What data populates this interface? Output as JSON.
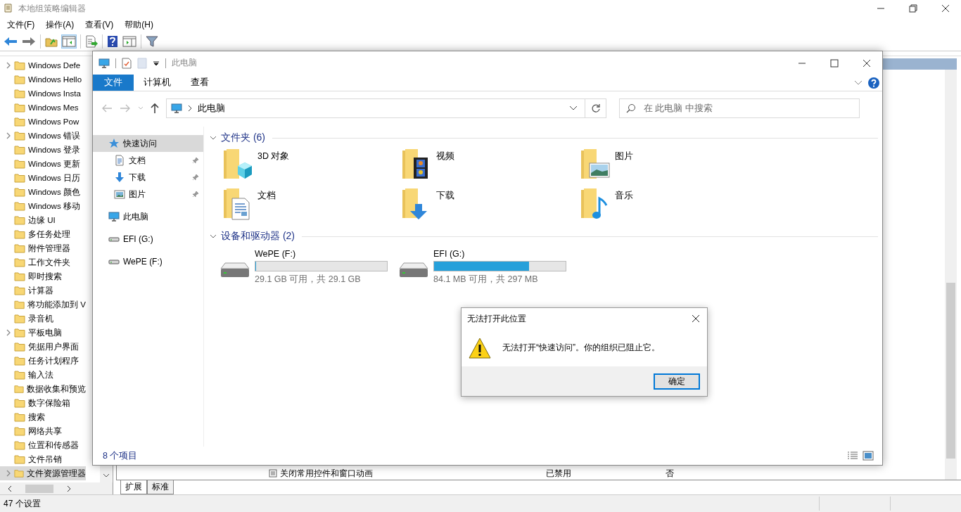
{
  "app_window": {
    "title": "本地组策略编辑器",
    "menu": [
      "文件(F)",
      "操作(A)",
      "查看(V)",
      "帮助(H)"
    ]
  },
  "tree": {
    "items": [
      {
        "label": "Windows Defe",
        "expandable": true,
        "selected": false
      },
      {
        "label": "Windows Hello",
        "expandable": false,
        "selected": false
      },
      {
        "label": "Windows Insta",
        "expandable": false,
        "selected": false
      },
      {
        "label": "Windows Mes",
        "expandable": false,
        "selected": false
      },
      {
        "label": "Windows Pow",
        "expandable": false,
        "selected": false
      },
      {
        "label": "Windows 错误",
        "expandable": true,
        "selected": false
      },
      {
        "label": "Windows 登录",
        "expandable": false,
        "selected": false
      },
      {
        "label": "Windows 更新",
        "expandable": false,
        "selected": false
      },
      {
        "label": "Windows 日历",
        "expandable": false,
        "selected": false
      },
      {
        "label": "Windows 颜色",
        "expandable": false,
        "selected": false
      },
      {
        "label": "Windows 移动",
        "expandable": false,
        "selected": false
      },
      {
        "label": "边缘 UI",
        "expandable": false,
        "selected": false
      },
      {
        "label": "多任务处理",
        "expandable": false,
        "selected": false
      },
      {
        "label": "附件管理器",
        "expandable": false,
        "selected": false
      },
      {
        "label": "工作文件夹",
        "expandable": false,
        "selected": false
      },
      {
        "label": "即时搜索",
        "expandable": false,
        "selected": false
      },
      {
        "label": "计算器",
        "expandable": false,
        "selected": false
      },
      {
        "label": "将功能添加到 V",
        "expandable": false,
        "selected": false
      },
      {
        "label": "录音机",
        "expandable": false,
        "selected": false
      },
      {
        "label": "平板电脑",
        "expandable": true,
        "selected": false
      },
      {
        "label": "凭据用户界面",
        "expandable": false,
        "selected": false
      },
      {
        "label": "任务计划程序",
        "expandable": false,
        "selected": false
      },
      {
        "label": "输入法",
        "expandable": false,
        "selected": false
      },
      {
        "label": "数据收集和预览",
        "expandable": false,
        "selected": false
      },
      {
        "label": "数字保险箱",
        "expandable": false,
        "selected": false
      },
      {
        "label": "搜索",
        "expandable": false,
        "selected": false
      },
      {
        "label": "网络共享",
        "expandable": false,
        "selected": false
      },
      {
        "label": "位置和传感器",
        "expandable": false,
        "selected": false
      },
      {
        "label": "文件吊销",
        "expandable": false,
        "selected": false
      },
      {
        "label": "文件资源管理器",
        "expandable": true,
        "selected": true
      }
    ]
  },
  "settings_table": {
    "rows": [
      {
        "name": "关闭常用控件和窗口动画",
        "state": "已禁用",
        "comment": "否"
      }
    ]
  },
  "view_tabs": [
    {
      "label": "扩展",
      "selected": true
    },
    {
      "label": "标准",
      "selected": false
    }
  ],
  "status_bar": "47 个设置",
  "explorer": {
    "title": "此电脑",
    "ribbon_tabs": [
      {
        "label": "文件",
        "selected": true
      },
      {
        "label": "计算机",
        "selected": false
      },
      {
        "label": "查看",
        "selected": false
      }
    ],
    "address": "此电脑",
    "search": {
      "placeholder": "在 此电脑 中搜索"
    },
    "nav": [
      {
        "label": "快速访问",
        "selected": true,
        "children": [
          {
            "label": "文档",
            "pinned": true,
            "selected": false
          },
          {
            "label": "下载",
            "pinned": true,
            "selected": false
          },
          {
            "label": "图片",
            "pinned": true,
            "selected": false
          }
        ]
      },
      {
        "label": "此电脑",
        "selected": false
      },
      {
        "label": "EFI (G:)",
        "selected": false
      },
      {
        "label": "WePE (F:)",
        "selected": false
      }
    ],
    "sections": [
      {
        "title": "文件夹 (6)",
        "kind": "folders",
        "expanded": true,
        "items": [
          {
            "label": "3D 对象"
          },
          {
            "label": "视频"
          },
          {
            "label": "图片"
          },
          {
            "label": "文档"
          },
          {
            "label": "下载"
          },
          {
            "label": "音乐"
          }
        ]
      },
      {
        "title": "设备和驱动器 (2)",
        "kind": "drives",
        "expanded": true,
        "items": [
          {
            "label": "WePE (F:)",
            "level": 0,
            "reading": "29.1 GB 可用，共 29.1 GB"
          },
          {
            "label": "EFI (G:)",
            "level": 0.72,
            "reading": "84.1 MB 可用，共 297 MB"
          }
        ]
      }
    ],
    "status": "8 个项目"
  },
  "dialog": {
    "title": "无法打开此位置",
    "message": "无法打开“快速访问”。你的组织已阻止它。",
    "buttons": [
      "确定"
    ]
  }
}
